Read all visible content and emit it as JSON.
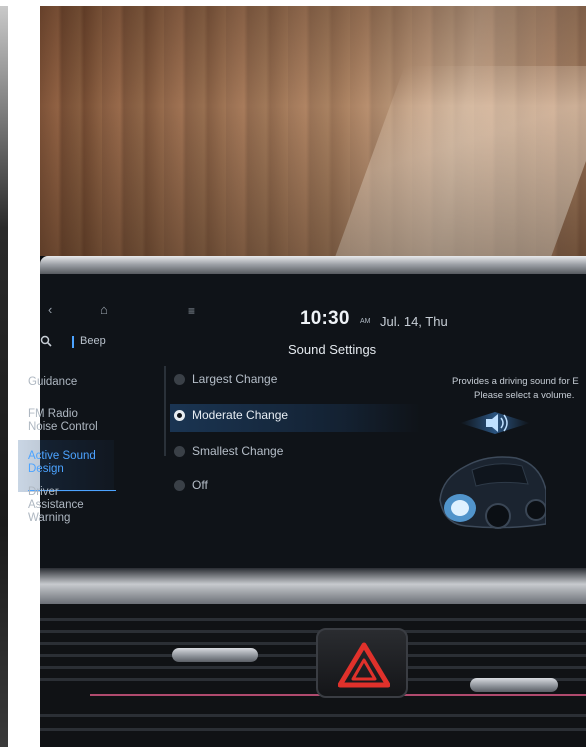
{
  "header": {
    "time": "10:30",
    "ampm": "AM",
    "date": "Jul. 14, Thu",
    "title": "Sound Settings"
  },
  "sidebar": {
    "beep_label": "Beep",
    "items": [
      {
        "label": "Guidance",
        "active": false
      },
      {
        "label": "FM Radio Noise Control",
        "active": false
      },
      {
        "label": "Active Sound Design",
        "active": true
      },
      {
        "label": "Driver Assistance Warning",
        "active": false
      }
    ]
  },
  "options": [
    {
      "label": "Largest Change",
      "selected": false
    },
    {
      "label": "Moderate Change",
      "selected": true
    },
    {
      "label": "Smallest Change",
      "selected": false
    },
    {
      "label": "Off",
      "selected": false
    }
  ],
  "description": {
    "line1": "Provides a driving sound for E",
    "line2": "Please select a volume."
  },
  "icons": {
    "back": "back-icon",
    "home": "home-icon",
    "search": "search-icon",
    "menu": "menu-icon",
    "hazard": "hazard-icon",
    "sound_wave": "sound-wave-icon"
  },
  "colors": {
    "accent": "#4ca3ff",
    "screen_bg": "#0f1318",
    "hazard_red": "#e0312b"
  }
}
